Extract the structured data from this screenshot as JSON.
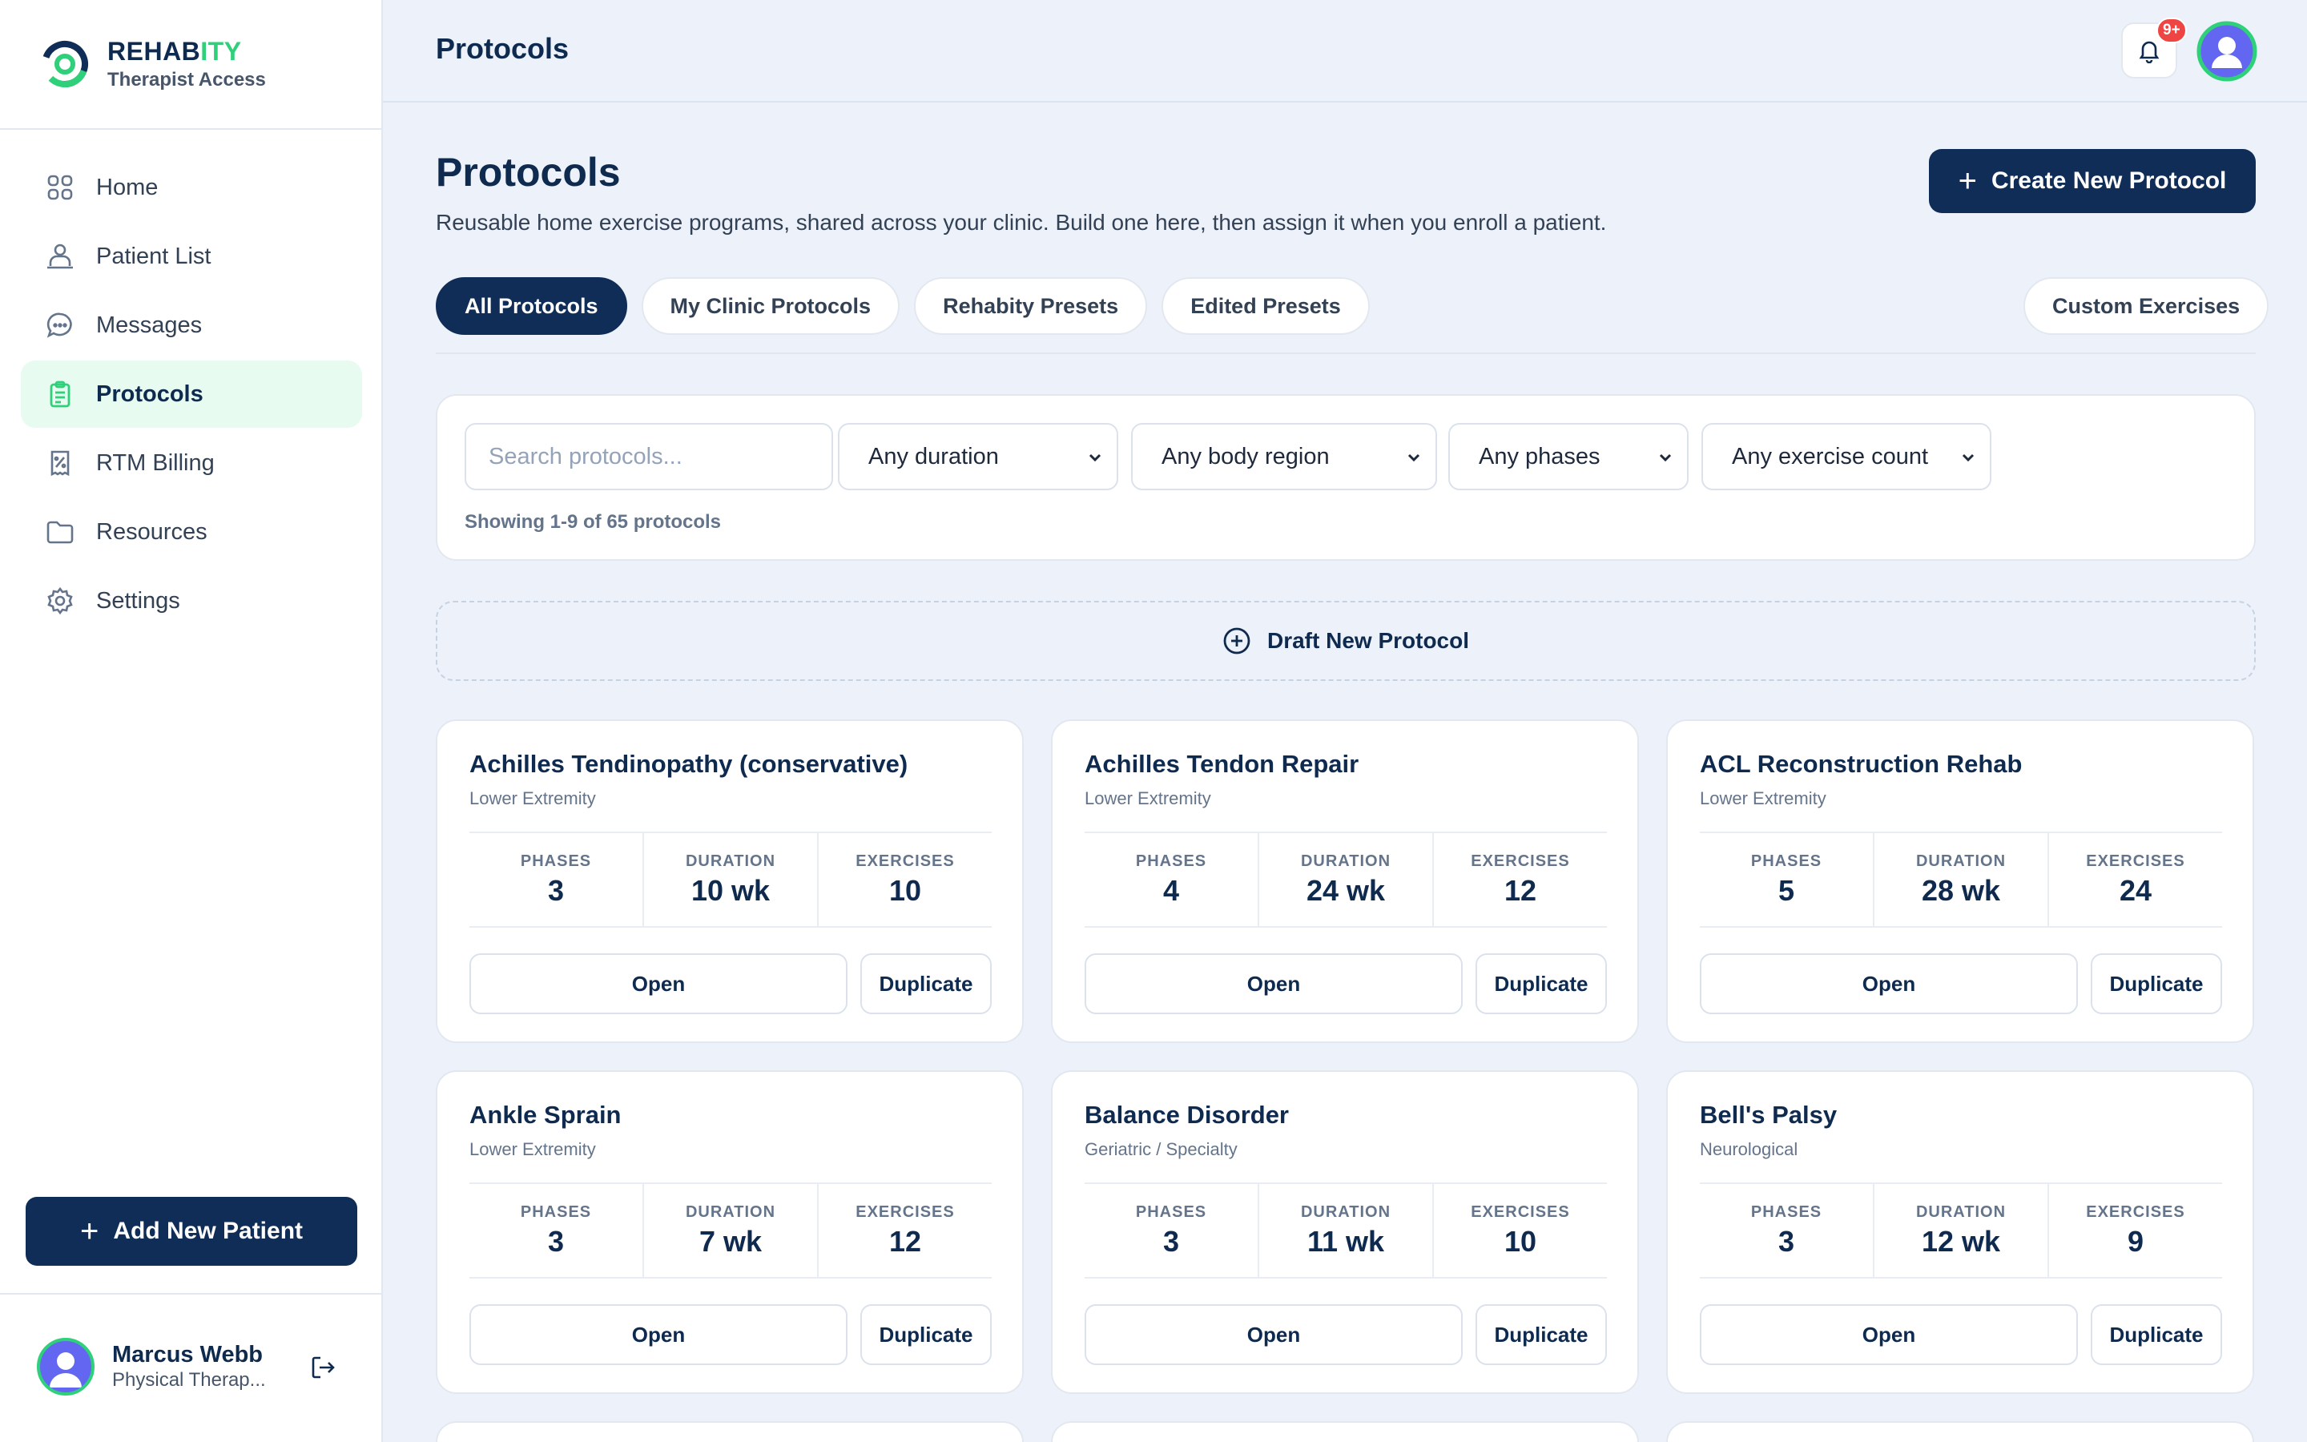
{
  "brand": {
    "name_main": "REHAB",
    "name_accent": "ITY",
    "subtitle": "Therapist Access",
    "accent_color": "#2fd07a",
    "primary_color": "#0f2d57"
  },
  "sidebar": {
    "items": [
      {
        "label": "Home",
        "icon": "grid-icon",
        "active": false
      },
      {
        "label": "Patient List",
        "icon": "patients-icon",
        "active": false
      },
      {
        "label": "Messages",
        "icon": "chat-icon",
        "active": false
      },
      {
        "label": "Protocols",
        "icon": "clipboard-icon",
        "active": true
      },
      {
        "label": "RTM Billing",
        "icon": "receipt-icon",
        "active": false
      },
      {
        "label": "Resources",
        "icon": "folder-icon",
        "active": false
      },
      {
        "label": "Settings",
        "icon": "gear-icon",
        "active": false
      }
    ],
    "add_patient_label": "Add New Patient",
    "user": {
      "name": "Marcus Webb",
      "role": "Physical Therap..."
    }
  },
  "topbar": {
    "title": "Protocols",
    "notification_badge": "9+"
  },
  "page": {
    "title": "Protocols",
    "subtitle": "Reusable home exercise programs, shared across your clinic. Build one here, then assign it when you enroll a patient.",
    "create_label": "Create New Protocol"
  },
  "tabs": [
    {
      "label": "All Protocols",
      "active": true
    },
    {
      "label": "My Clinic Protocols",
      "active": false
    },
    {
      "label": "Rehabity Presets",
      "active": false
    },
    {
      "label": "Edited Presets",
      "active": false
    }
  ],
  "custom_tab_label": "Custom Exercises",
  "filters": {
    "search_placeholder": "Search protocols...",
    "duration": "Any duration",
    "body_region": "Any body region",
    "phases": "Any phases",
    "exercise_count": "Any exercise count",
    "count_text": "Showing 1-9 of 65 protocols"
  },
  "draft_label": "Draft New Protocol",
  "stat_labels": {
    "phases": "PHASES",
    "duration": "DURATION",
    "exercises": "EXERCISES"
  },
  "card_actions": {
    "open": "Open",
    "duplicate": "Duplicate"
  },
  "protocols": [
    {
      "title": "Achilles Tendinopathy (conservative)",
      "category": "Lower Extremity",
      "phases": "3",
      "duration": "10 wk",
      "exercises": "10"
    },
    {
      "title": "Achilles Tendon Repair",
      "category": "Lower Extremity",
      "phases": "4",
      "duration": "24 wk",
      "exercises": "12"
    },
    {
      "title": "ACL Reconstruction Rehab",
      "category": "Lower Extremity",
      "phases": "5",
      "duration": "28 wk",
      "exercises": "24"
    },
    {
      "title": "Ankle Sprain",
      "category": "Lower Extremity",
      "phases": "3",
      "duration": "7 wk",
      "exercises": "12"
    },
    {
      "title": "Balance Disorder",
      "category": "Geriatric / Specialty",
      "phases": "3",
      "duration": "11 wk",
      "exercises": "10"
    },
    {
      "title": "Bell's Palsy",
      "category": "Neurological",
      "phases": "3",
      "duration": "12 wk",
      "exercises": "9"
    }
  ]
}
